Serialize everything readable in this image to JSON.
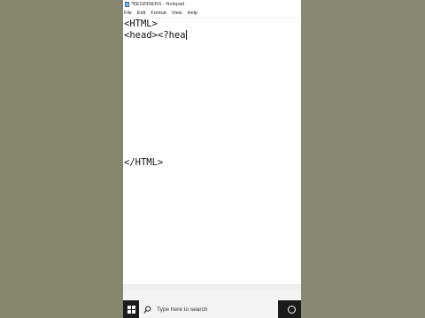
{
  "window": {
    "title": "*BEGINNERS - Notepad"
  },
  "menu": {
    "items": [
      "File",
      "Edit",
      "Format",
      "View",
      "Help"
    ]
  },
  "editor": {
    "lines": [
      "<HTML>",
      "<head><?hea",
      "</HTML>"
    ]
  },
  "taskbar": {
    "search_placeholder": "Type here to search",
    "start_icon": "windows-logo-icon",
    "search_icon": "search-icon",
    "cortana_icon": "cortana-icon"
  },
  "colors": {
    "background": "#868671",
    "taskbar": "#1b1b1b"
  }
}
